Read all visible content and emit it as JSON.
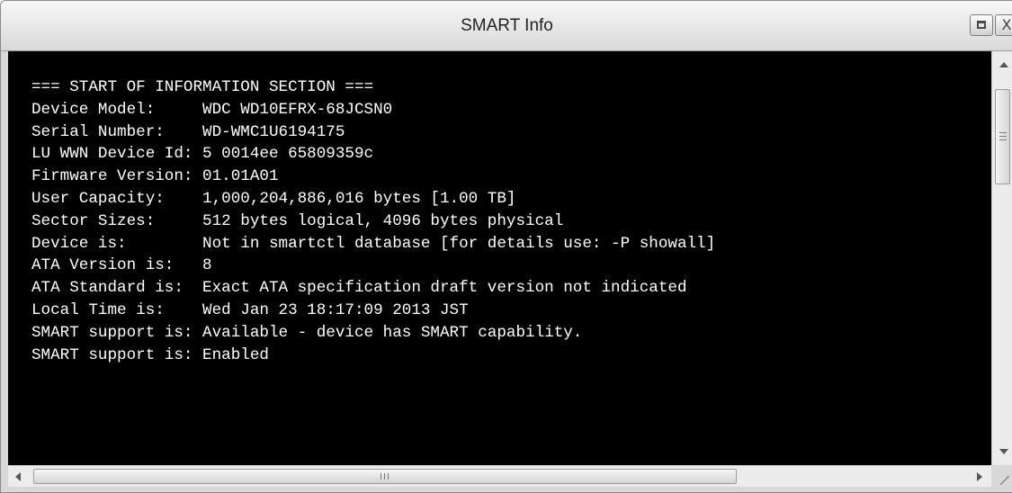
{
  "window": {
    "title": "SMART Info"
  },
  "titlebar": {
    "restore_icon": "restore-icon",
    "close_icon": "close-icon",
    "close_glyph": "X"
  },
  "terminal": {
    "lines": [
      "=== START OF INFORMATION SECTION ===",
      "Device Model:     WDC WD10EFRX-68JCSN0",
      "Serial Number:    WD-WMC1U6194175",
      "LU WWN Device Id: 5 0014ee 65809359c",
      "Firmware Version: 01.01A01",
      "User Capacity:    1,000,204,886,016 bytes [1.00 TB]",
      "Sector Sizes:     512 bytes logical, 4096 bytes physical",
      "Device is:        Not in smartctl database [for details use: -P showall]",
      "ATA Version is:   8",
      "ATA Standard is:  Exact ATA specification draft version not indicated",
      "Local Time is:    Wed Jan 23 18:17:09 2013 JST",
      "SMART support is: Available - device has SMART capability.",
      "SMART support is: Enabled"
    ]
  },
  "scrollbars": {
    "vertical_position": 0.0,
    "horizontal_position": 0.0
  },
  "colors": {
    "terminal_background": "#000000",
    "terminal_text": "#ffffff",
    "chrome": "#d8d8d8"
  }
}
